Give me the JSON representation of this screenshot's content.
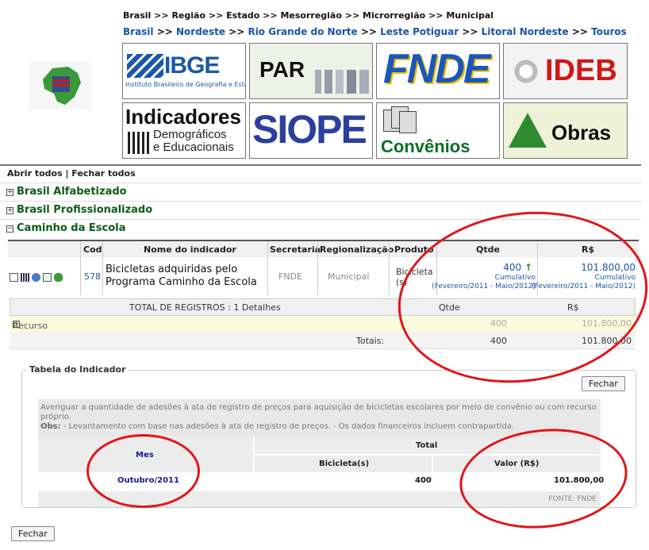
{
  "breadcrumb_levels": [
    "Brasil",
    ">>",
    "Região",
    ">>",
    "Estado",
    ">>",
    "Mesorregião",
    ">>",
    "Microrregião",
    ">>",
    "Municipal"
  ],
  "breadcrumb_links": [
    "Brasil",
    "Nordeste",
    "Rio Grande do Norte",
    "Leste Potiguar",
    "Litoral Nordeste",
    "Touros"
  ],
  "tiles": {
    "ibge": "IBGE",
    "ibge_sub": "Instituto Brasileiro de Geografia e Estatística",
    "par": "PAR",
    "fnde": "FNDE",
    "ideb": "IDEB",
    "ind1": "Indicadores",
    "ind2": "Demográficos",
    "ind3": "e Educacionais",
    "siope": "SIOPE",
    "conv": "Convênios",
    "obras": "Obras"
  },
  "toggle_all": "Abrir todos | Fechar todos",
  "sections": [
    "Brasil Alfabetizado",
    "Brasil Profissionalizado",
    "Caminho da Escola"
  ],
  "headers": {
    "cod": "Cod",
    "nome": "Nome do indicador",
    "secretaria": "Secretaria",
    "reg": "Regionalização",
    "prod": "Produto",
    "qtde": "Qtde",
    "rs": "R$"
  },
  "row": {
    "cod": "578",
    "nome": "Bicicletas adquiridas pelo Programa Caminho da Escola",
    "secretaria": "FNDE",
    "reg": "Municipal",
    "prod": "Bicicleta (s)",
    "qtde": "400",
    "rs": "101.800,00",
    "cum": "Cumulativo",
    "period": "(Fevereiro/2011 - Maio/2012)"
  },
  "detail": {
    "total_registros": "TOTAL DE REGISTROS : 1 Detalhes",
    "qtde": "Qtde",
    "rs": "R$",
    "recurso": "Recurso Próprio",
    "rec_qtde": "400",
    "rec_rs": "101.800,00",
    "totais": "Totais:",
    "tot_qtde": "400",
    "tot_rs": "101.800,00"
  },
  "indicador": {
    "title": "Tabela do Indicador",
    "fechar": "Fechar",
    "desc": "Averiguar a quantidade de adesões à ata de registro de preços para aquisição de bicicletas escolares por meio de convênio ou com recurso próprio.",
    "obs_label": "Obs:",
    "obs": " - Levantamento com base nas adesões à ata de registro de preços. - Os dados financeiros incluem contrapartida.",
    "mes": "Mes",
    "total": "Total",
    "bicicletas": "Bicicleta(s)",
    "valor": "Valor (R$)",
    "mes_val": "Outubro/2011",
    "bic_val": "400",
    "valor_val": "101.800,00",
    "fonte": "FONTE: FNDE"
  },
  "fechar_bottom": "Fechar"
}
